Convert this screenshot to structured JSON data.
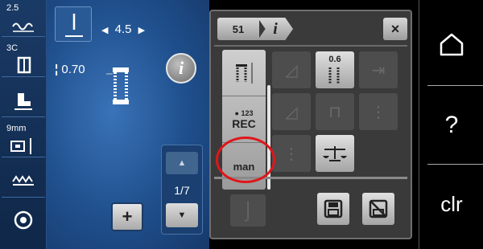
{
  "left_bar": {
    "items": [
      {
        "label": "2.5",
        "icon": "stitch-length-icon"
      },
      {
        "label": "3C",
        "icon": "presser-foot-icon"
      },
      {
        "label": "",
        "icon": "presser-foot-pressure-icon"
      },
      {
        "label": "9mm",
        "icon": "needle-plate-icon"
      },
      {
        "label": "",
        "icon": "feed-dog-icon"
      },
      {
        "label": "",
        "icon": "bobbin-icon"
      }
    ]
  },
  "main": {
    "width_value": "4.5",
    "tension_value": "0.70",
    "info_label": "i",
    "page_indicator": "1/7",
    "add_label": "+"
  },
  "panel": {
    "tab_number": "51",
    "tab_info_label": "i",
    "close_label": "×",
    "rec_small": "● 123",
    "rec_label": "REC",
    "man_label": "man",
    "length_value": "0.6"
  },
  "right_bar": {
    "home_icon": "home-icon",
    "help_label": "?",
    "clr_label": "clr"
  },
  "colors": {
    "main_blue": "#1f4f8c",
    "panel_gray": "#3a3a3a",
    "highlight_red": "#e0161b"
  }
}
